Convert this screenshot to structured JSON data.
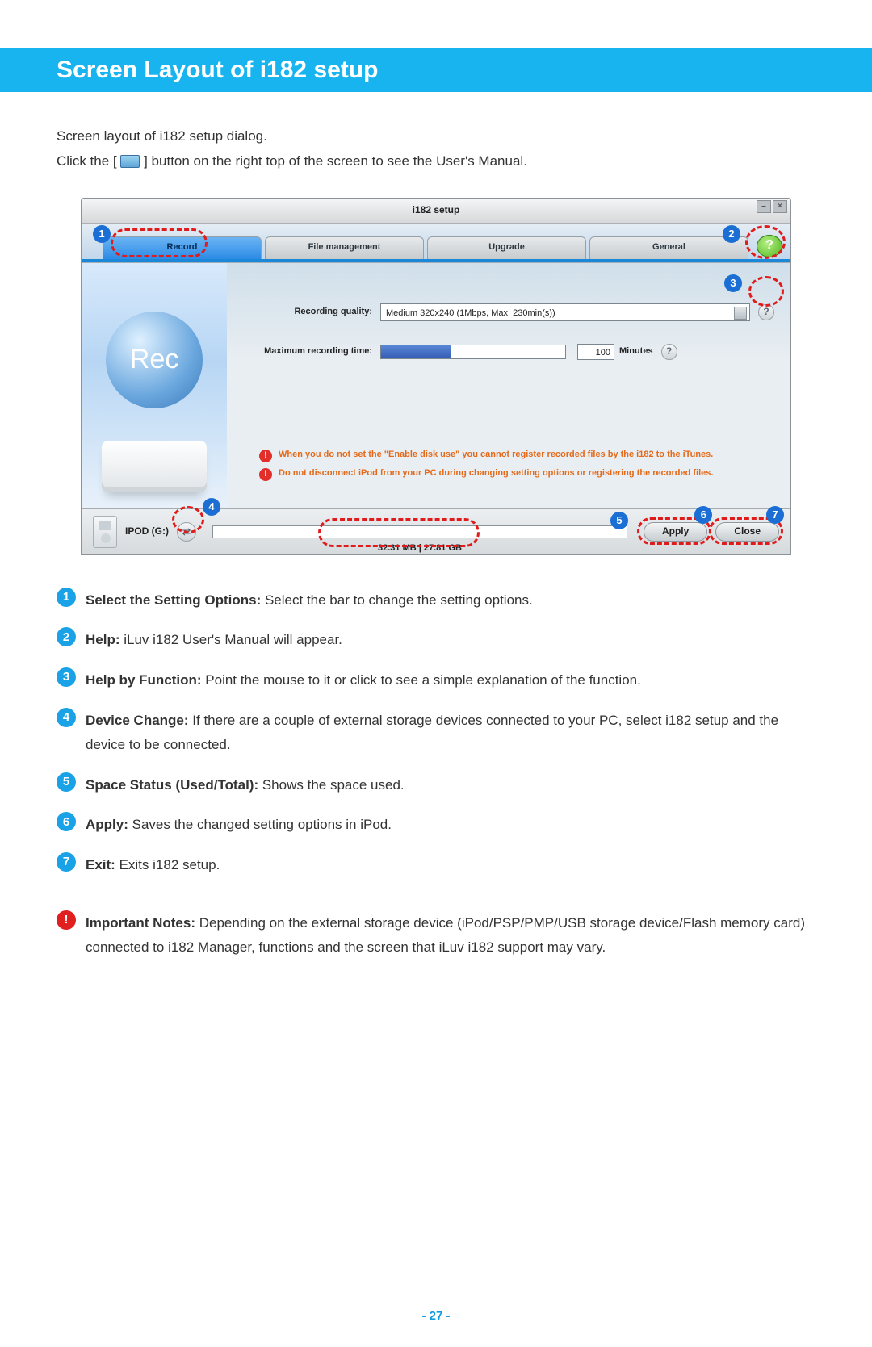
{
  "header": {
    "title": "Screen Layout of i182 setup"
  },
  "intro": {
    "line1": "Screen layout of i182 setup dialog.",
    "line2_a": "Click the [",
    "line2_b": "] button on the right top of the screen to see the User's Manual."
  },
  "window": {
    "title": "i182 setup",
    "tabs": {
      "record": "Record",
      "file_mgmt": "File management",
      "upgrade": "Upgrade",
      "general": "General"
    },
    "help_symbol": "?",
    "rec_label": "Rec",
    "quality": {
      "label": "Recording quality:",
      "value": "Medium 320x240 (1Mbps, Max. 230min(s))"
    },
    "max_time": {
      "label": "Maximum recording time:",
      "value": "100",
      "unit": "Minutes"
    },
    "warnings": {
      "w1": "When you do not set the \"Enable disk use\" you cannot register recorded files by the i182 to the iTunes.",
      "w2": "Do not disconnect iPod from your PC during changing setting options or registering the recorded files."
    },
    "footer": {
      "device": "IPOD (G:)",
      "space": "32.31 MB | 27.81 GB",
      "apply": "Apply",
      "close": "Close"
    }
  },
  "legend": {
    "i1_t": "Select the Setting Options:",
    "i1_d": " Select the bar to change the setting options.",
    "i2_t": "Help:",
    "i2_d": " iLuv i182 User's Manual will appear.",
    "i3_t": "Help by Function:",
    "i3_d": " Point the mouse to it or click to see a simple explanation of the function.",
    "i4_t": "Device Change:",
    "i4_d": " If there are a couple of external storage devices connected to your PC, select i182 setup and the device to be connected.",
    "i5_t": "Space Status (Used/Total):",
    "i5_d": " Shows the space used.",
    "i6_t": "Apply:",
    "i6_d": " Saves the changed setting options in iPod.",
    "i7_t": "Exit:",
    "i7_d": " Exits i182 setup.",
    "imp_t": "Important Notes:",
    "imp_d": " Depending on the external storage device (iPod/PSP/PMP/USB storage device/Flash memory card) connected to i182 Manager, functions and the screen that iLuv i182 support may vary."
  },
  "page_number": "- 27 -"
}
